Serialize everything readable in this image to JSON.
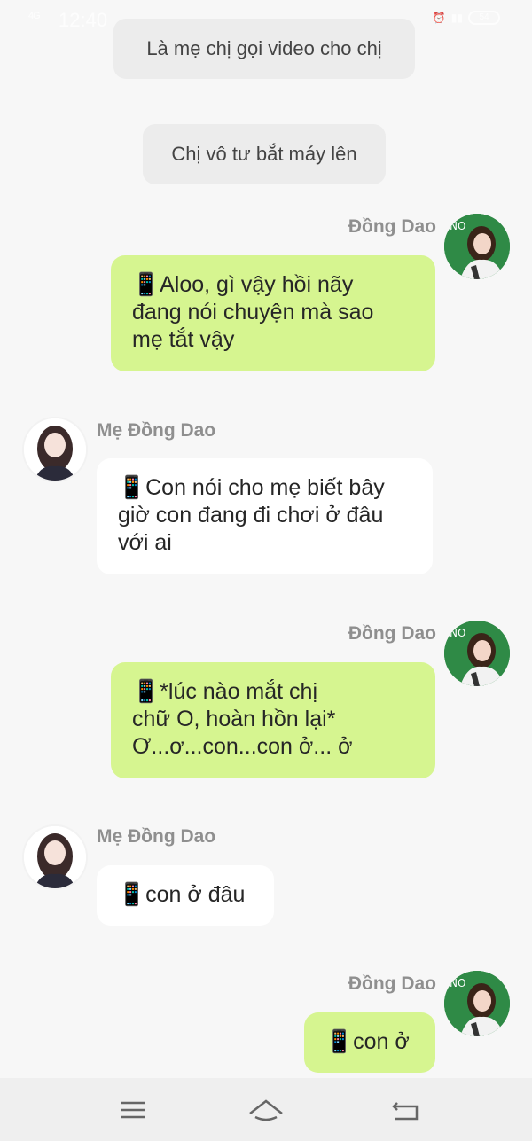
{
  "status_bar": {
    "time": "12:40",
    "signal": "4G",
    "battery": "54"
  },
  "system_messages": [
    "Là mẹ chị gọi video cho chị",
    "Chị vô tư bắt máy lên"
  ],
  "messages": [
    {
      "sender": "Đồng Dao",
      "side": "right",
      "icon": "phone-icon",
      "text": "📱Aloo, gì vậy hồi nãy\nđang nói chuyện mà sao\nmẹ tắt vậy"
    },
    {
      "sender": "Mẹ Đồng Dao",
      "side": "left",
      "icon": "phone-icon",
      "text": "📱Con nói cho mẹ biết bây\ngiờ con đang đi chơi ở đâu\nvới ai"
    },
    {
      "sender": "Đồng Dao",
      "side": "right",
      "icon": "phone-icon",
      "text": "📱*lúc nào mắt chị\nchữ O, hoàn hồn lại*\nƠ...ơ...con...con ở... ở"
    },
    {
      "sender": "Mẹ Đồng Dao",
      "side": "left",
      "icon": "phone-icon",
      "text": "📱con ở đâu"
    },
    {
      "sender": "Đồng Dao",
      "side": "right",
      "icon": "phone-icon",
      "text": "📱con ở"
    }
  ],
  "nav": {
    "icons": [
      "menu-icon",
      "home-icon",
      "back-icon"
    ]
  },
  "colors": {
    "background": "#f7f7f7",
    "right_bubble": "#d6f590",
    "left_bubble": "#ffffff",
    "system_bubble": "#ececec"
  }
}
